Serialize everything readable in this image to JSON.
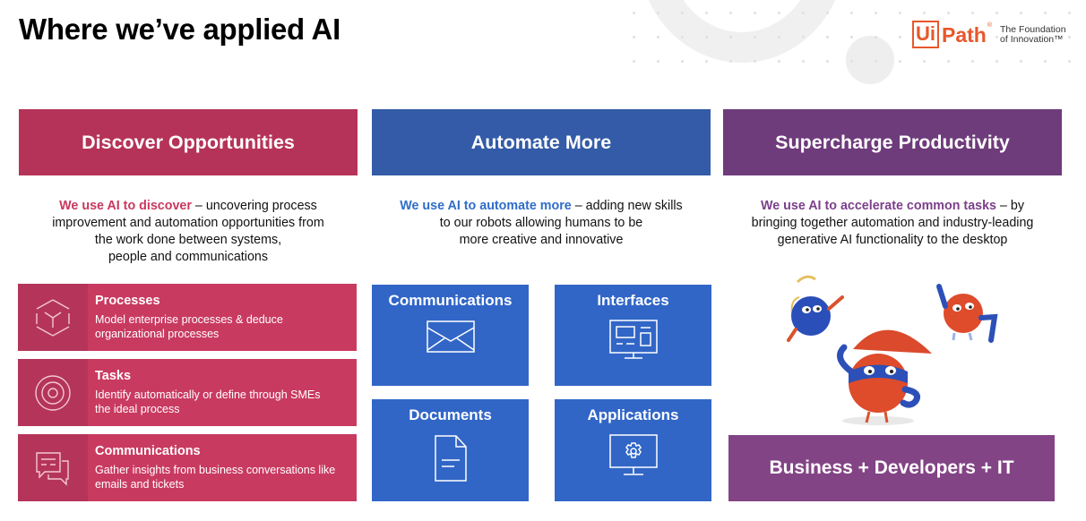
{
  "page": {
    "title": "Where we’ve applied AI"
  },
  "logo": {
    "mark_box": "Ui",
    "mark_text": "Path",
    "registered": "®",
    "tagline_line1": "The Foundation",
    "tagline_line2": "of Innovation™",
    "brand_color": "#e8572b"
  },
  "columns": [
    {
      "id": "discover",
      "header": "Discover Opportunities",
      "color": "#b53358",
      "desc_highlight": "We use AI to discover",
      "desc_rest_line1": " – uncovering process",
      "desc_lines": [
        "improvement and automation opportunities from",
        "the work done between systems,",
        "people and communications"
      ],
      "cards": [
        {
          "icon": "cube-icon",
          "title": "Processes",
          "desc_line1": "Model enterprise processes & deduce",
          "desc_line2": "organizational processes"
        },
        {
          "icon": "target-icon",
          "title": "Tasks",
          "desc_line1": "Identify automatically or define through SMEs",
          "desc_line2": "the ideal process"
        },
        {
          "icon": "chat-bubbles-icon",
          "title": "Communications",
          "desc_line1": "Gather insights from business conversations like",
          "desc_line2": "emails and tickets"
        }
      ]
    },
    {
      "id": "automate",
      "header": "Automate More",
      "color": "#335ba7",
      "desc_highlight": "We use AI to automate more",
      "desc_rest_line1": " – adding new skills",
      "desc_lines": [
        "to our robots allowing humans to be",
        "more creative and innovative"
      ],
      "tiles": [
        {
          "icon": "envelope-icon",
          "title": "Communications"
        },
        {
          "icon": "interface-monitor-icon",
          "title": "Interfaces"
        },
        {
          "icon": "document-icon",
          "title": "Documents"
        },
        {
          "icon": "gear-monitor-icon",
          "title": "Applications"
        }
      ]
    },
    {
      "id": "supercharge",
      "header": "Supercharge Productivity",
      "color": "#6e3b7b",
      "desc_highlight": "We use AI to accelerate common tasks",
      "desc_rest_line1": " – by",
      "desc_lines": [
        "bringing together automation and industry-leading",
        "generative AI functionality to the desktop"
      ],
      "illustration": "robot-mascots",
      "banner": "Business + Developers + IT"
    }
  ]
}
